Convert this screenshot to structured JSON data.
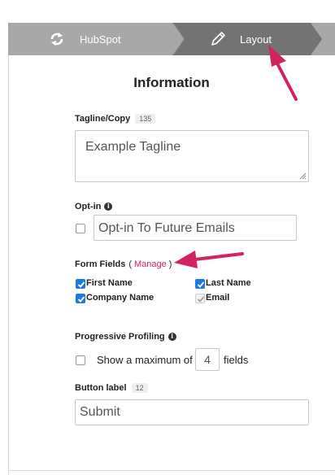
{
  "steps": [
    {
      "label": "HubSpot",
      "icon": "sync-icon",
      "state": "completed"
    },
    {
      "label": "Layout",
      "icon": "pencil-icon",
      "state": "active"
    }
  ],
  "section_title": "Information",
  "tagline": {
    "label": "Tagline/Copy",
    "count": "135",
    "value": "Example Tagline"
  },
  "optin": {
    "label": "Opt-in",
    "checked": false,
    "value": "Opt-in To Future Emails"
  },
  "form_fields": {
    "label": "Form Fields",
    "paren_open": "(",
    "manage_link": "Manage",
    "paren_close": ")",
    "fields": [
      {
        "label": "First Name",
        "checked": true
      },
      {
        "label": "Last Name",
        "checked": true
      },
      {
        "label": "Company Name",
        "checked": true
      },
      {
        "label": "Email",
        "checked": true,
        "disabled": true
      }
    ]
  },
  "progressive_profiling": {
    "label": "Progressive Profiling",
    "checked": false,
    "prefix": "Show a maximum of",
    "value": "4",
    "suffix": "fields"
  },
  "button_label": {
    "label": "Button label",
    "count": "12",
    "value": "Submit"
  },
  "colors": {
    "accent": "#d2235f",
    "checkbox": "#1f7ae0",
    "step_done": "#a8a8a8",
    "step_active": "#737373"
  }
}
